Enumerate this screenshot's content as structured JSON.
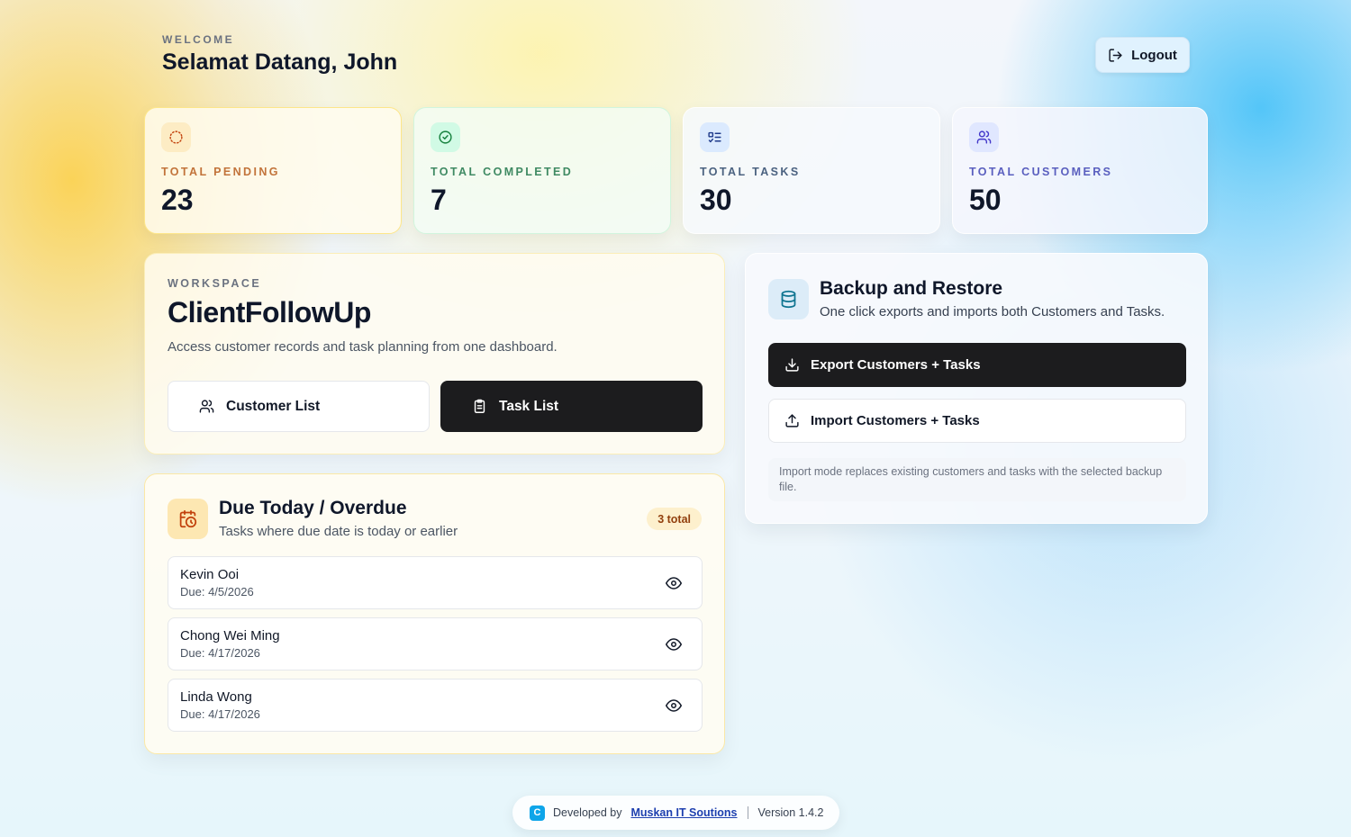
{
  "header": {
    "welcome_label": "WELCOME",
    "greeting": "Selamat Datang, John",
    "logout_label": "Logout"
  },
  "stats": {
    "pending": {
      "label": "TOTAL PENDING",
      "value": "23",
      "icon": "loader-icon"
    },
    "completed": {
      "label": "TOTAL COMPLETED",
      "value": "7",
      "icon": "check-circle-icon"
    },
    "tasks": {
      "label": "TOTAL TASKS",
      "value": "30",
      "icon": "task-list-icon"
    },
    "customers": {
      "label": "TOTAL CUSTOMERS",
      "value": "50",
      "icon": "users-icon"
    }
  },
  "workspace": {
    "label": "WORKSPACE",
    "title": "ClientFollowUp",
    "description": "Access customer records and task planning from one dashboard.",
    "customer_list_label": "Customer List",
    "task_list_label": "Task List"
  },
  "due": {
    "title": "Due Today / Overdue",
    "subtitle": "Tasks where due date is today or earlier",
    "badge": "3 total",
    "items": [
      {
        "name": "Kevin Ooi",
        "due": "Due: 4/5/2026"
      },
      {
        "name": "Chong Wei Ming",
        "due": "Due: 4/17/2026"
      },
      {
        "name": "Linda Wong",
        "due": "Due: 4/17/2026"
      }
    ]
  },
  "backup": {
    "title": "Backup and Restore",
    "subtitle": "One click exports and imports both Customers and Tasks.",
    "export_label": "Export Customers + Tasks",
    "import_label": "Import Customers + Tasks",
    "note": "Import mode replaces existing customers and tasks with the selected backup file."
  },
  "footer": {
    "developed_by": "Developed by",
    "company": "Muskan IT Soutions",
    "version": "Version 1.4.2"
  },
  "colors": {
    "primary_dark": "#1c1c1e",
    "pending_accent": "#c2733a",
    "completed_accent": "#3f8a63",
    "customers_accent": "#5a5fbf"
  }
}
